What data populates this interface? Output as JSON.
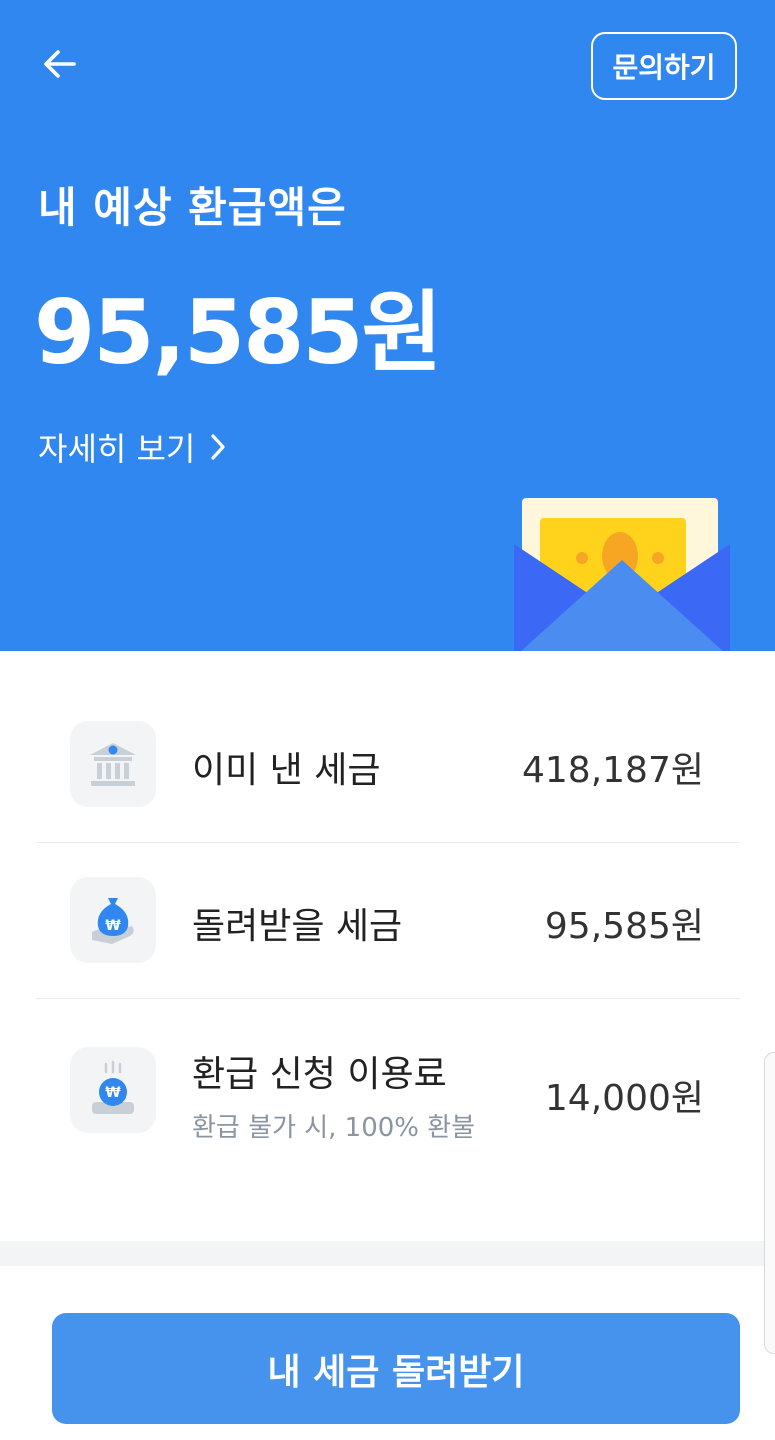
{
  "header": {
    "back_icon": "arrow-left-icon",
    "inquiry_label": "문의하기"
  },
  "summary": {
    "subtitle": "내 예상 환급액은",
    "amount": "95,585원",
    "detail_label": "자세히 보기",
    "detail_icon": "chevron-right-icon",
    "illustration": "envelope-money-icon"
  },
  "rows": [
    {
      "icon": "bank-icon",
      "label": "이미 낸 세금",
      "value": "418,187원"
    },
    {
      "icon": "money-bag-icon",
      "label": "돌려받을 세금",
      "value": "95,585원"
    },
    {
      "icon": "hot-coin-icon",
      "label": "환급 신청 이용료",
      "sub": "환급 불가 시, 100% 환불",
      "value": "14,000원"
    }
  ],
  "cta": {
    "label": "내 세금 돌려받기"
  },
  "colors": {
    "primary": "#3187f0",
    "button": "#4593ec",
    "icon_bg": "#f2f4f6"
  }
}
